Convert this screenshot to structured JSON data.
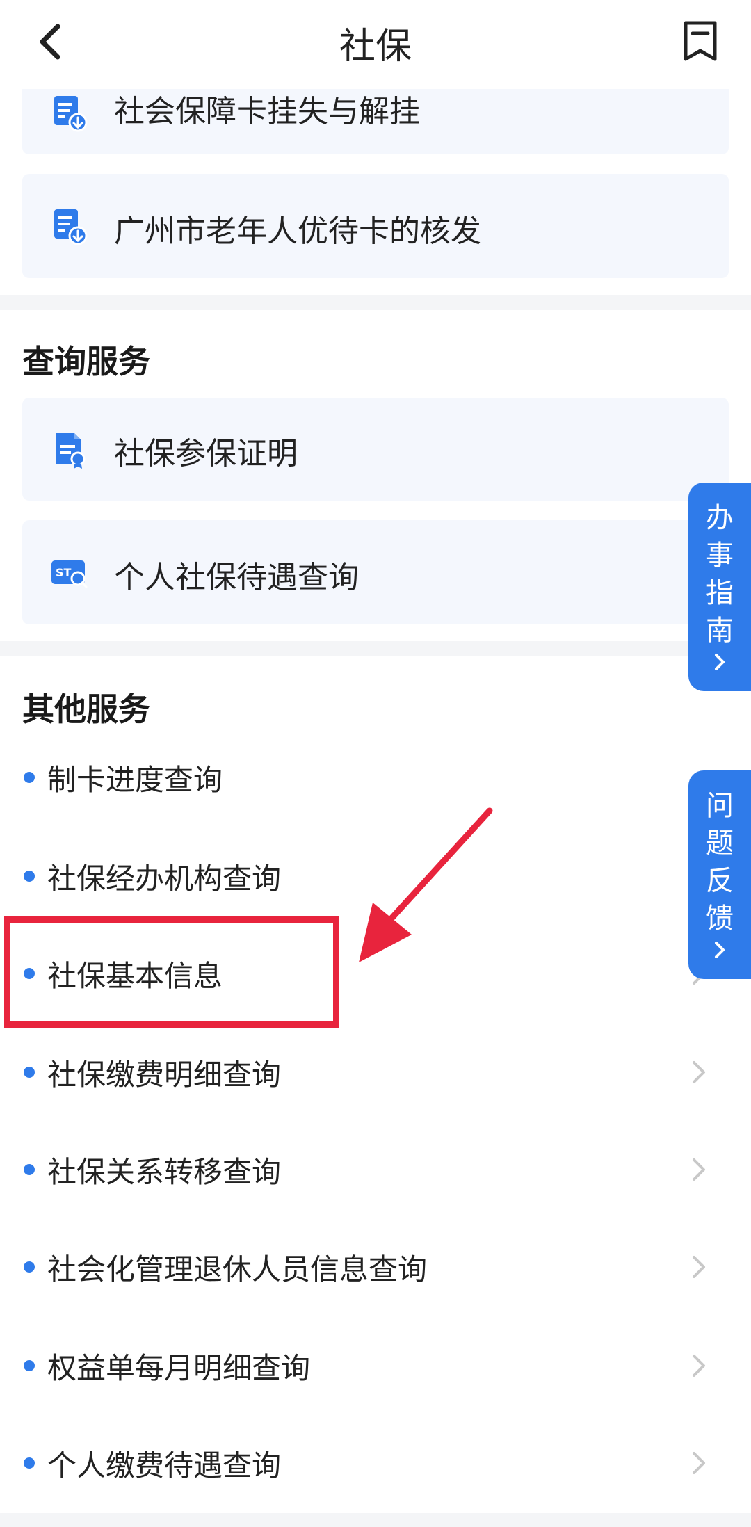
{
  "header": {
    "title": "社保",
    "back_icon": "chevron-left-icon",
    "bookmark_icon": "bookmark-icon"
  },
  "top_cards": [
    {
      "label": "社会保障卡挂失与解挂",
      "icon": "form-download-icon"
    },
    {
      "label": "广州市老年人优待卡的核发",
      "icon": "form-download-icon"
    }
  ],
  "query_section": {
    "title": "查询服务",
    "items": [
      {
        "label": "社保参保证明",
        "icon": "certificate-doc-icon"
      },
      {
        "label": "个人社保待遇查询",
        "icon": "card-search-icon"
      }
    ]
  },
  "other_section": {
    "title": "其他服务",
    "items": [
      {
        "label": "制卡进度查询"
      },
      {
        "label": "社保经办机构查询"
      },
      {
        "label": "社保基本信息"
      },
      {
        "label": "社保缴费明细查询"
      },
      {
        "label": "社保关系转移查询"
      },
      {
        "label": "社会化管理退休人员信息查询"
      },
      {
        "label": "权益单每月明细查询"
      },
      {
        "label": "个人缴费待遇查询"
      }
    ]
  },
  "side_tabs": [
    {
      "label": "办事指南"
    },
    {
      "label": "问题反馈"
    }
  ],
  "colors": {
    "accent": "#2f7bea",
    "card_bg": "#f4f7fd",
    "highlight": "#e8243d"
  }
}
